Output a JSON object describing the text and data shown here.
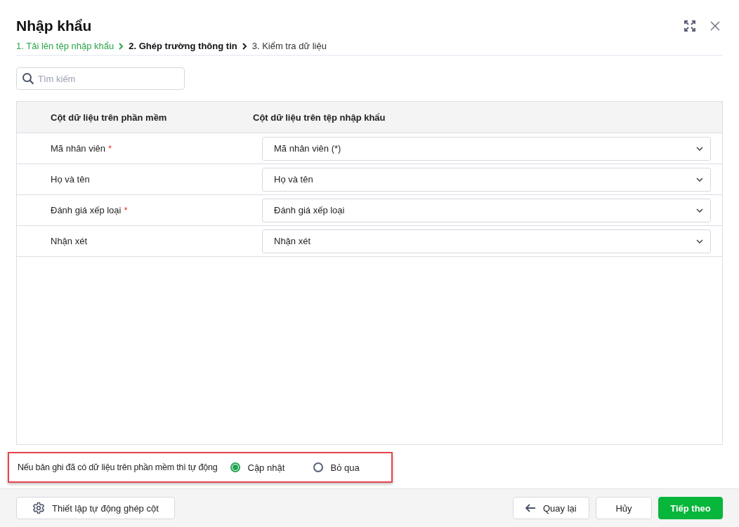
{
  "window": {
    "title": "Nhập khẩu"
  },
  "steps": [
    {
      "label": "1. Tải lên tệp nhập khẩu",
      "completed": true,
      "selected": false
    },
    {
      "label": "2. Ghép trường thông tin",
      "completed": false,
      "selected": true
    },
    {
      "label": "3. Kiểm tra dữ liệu",
      "completed": false,
      "selected": false
    }
  ],
  "search": {
    "placeholder": "Tìm kiếm"
  },
  "table": {
    "columns": [
      "Cột dữ liệu trên phần mềm",
      "Cột dữ liệu trên tệp nhập khẩu"
    ],
    "rows": [
      {
        "field": "Mã nhân viên",
        "required_mark": "*",
        "mapped": "Mã nhân viên (*)"
      },
      {
        "field": "Họ và tên",
        "mapped": "Họ và tên"
      },
      {
        "field": "Đánh giá xếp loại",
        "required_mark": "*",
        "mapped": "Đánh giá xếp loại"
      },
      {
        "field": "Nhận xét",
        "mapped": "Nhận xét"
      }
    ]
  },
  "existing_records": {
    "label": "Nếu bản ghi đã có dữ liệu trên phần mềm thì tự động",
    "highlighted": true,
    "options": [
      {
        "label": "Cập nhật",
        "selected": true
      },
      {
        "label": "Bỏ qua",
        "selected": false
      }
    ]
  },
  "footer": {
    "settings_button": "Thiết lập tự động ghép cột",
    "back_button": "Quay lại",
    "cancel_button": "Hủy",
    "next_button": "Tiếp theo"
  }
}
